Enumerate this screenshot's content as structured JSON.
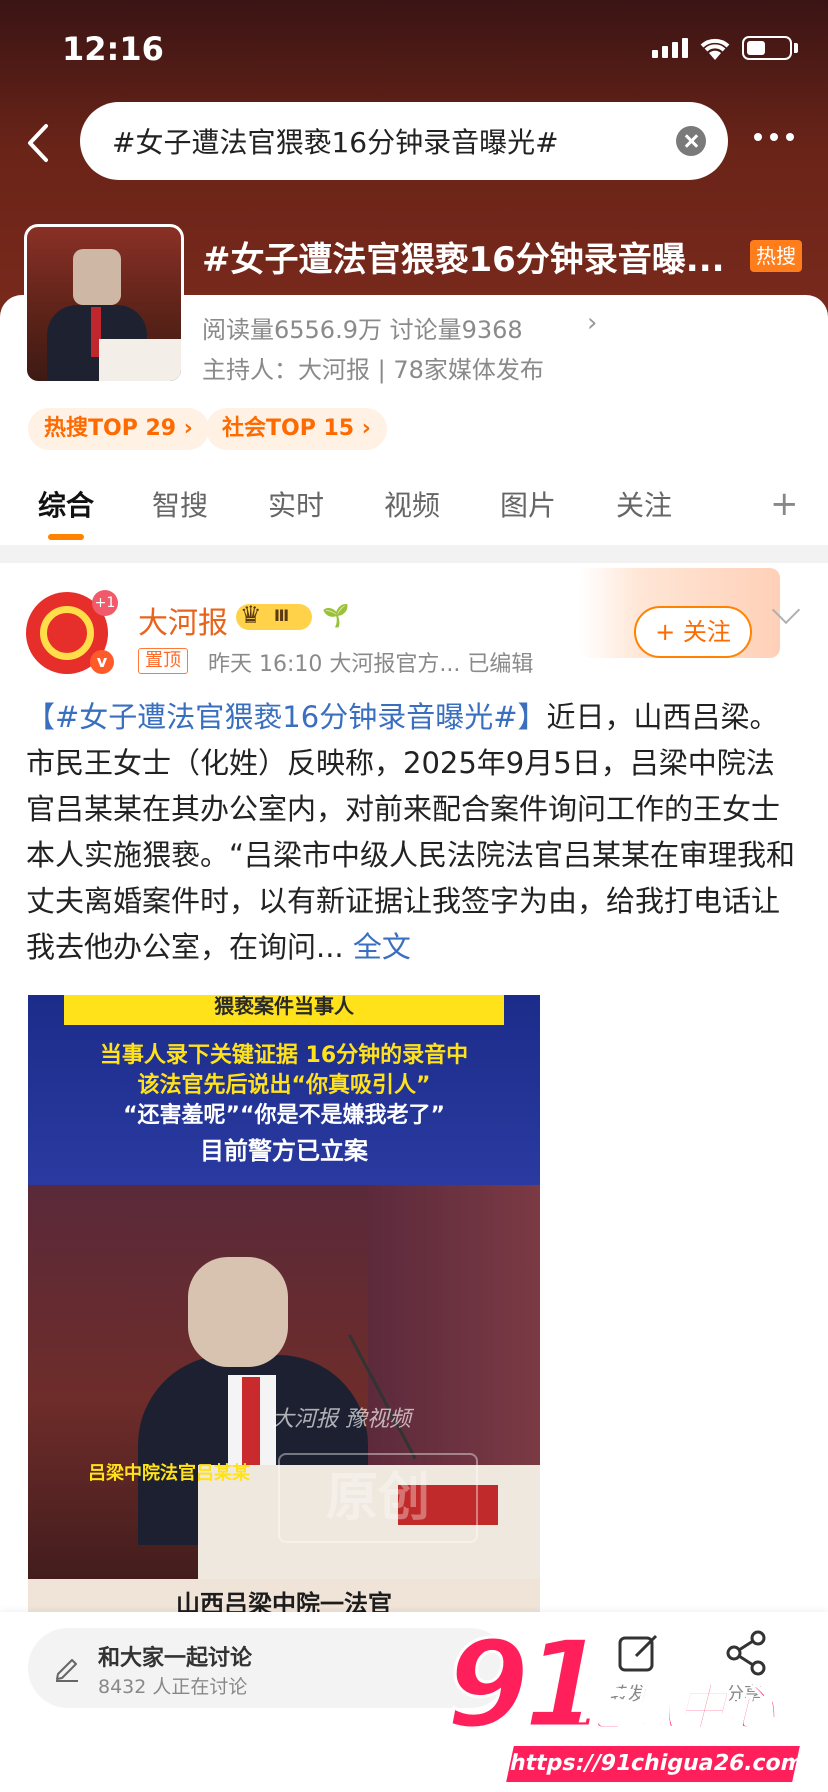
{
  "status_bar": {
    "time": "12:16"
  },
  "search": {
    "query": "#女子遭法官猥亵16分钟录音曝光#"
  },
  "topic": {
    "title": "#女子遭法官猥亵16分钟录音曝...",
    "hot_badge": "热搜",
    "stats": "阅读量6556.9万  讨论量9368",
    "host": "主持人：大河报 | 78家媒体发布",
    "rank_tags": [
      "热搜TOP 29 ›",
      "社会TOP 15 ›"
    ]
  },
  "tabs": [
    "综合",
    "智搜",
    "实时",
    "视频",
    "图片",
    "关注"
  ],
  "post": {
    "author": "大河报",
    "avatar_plus": "+1",
    "avatar_v": "v",
    "pin_label": "置顶",
    "meta": "昨天 16:10  大河报官方...  已编辑",
    "follow_label": "+ 关注",
    "body_hashtag": "【#女子遭法官猥亵16分钟录音曝光#】",
    "body_text": "近日，山西吕梁。市民王女士（化姓）反映称，2025年9月5日，吕梁中院法官吕某某在其办公室内，对前来配合案件询问工作的王女士本人实施猥亵。“吕梁市中级人民法院法官吕某某在审理我和丈夫离婚案件时，以有新证据让我签字为由，给我打电话让我去他办公室，在询问...",
    "body_more": "全文"
  },
  "video": {
    "top_bar": "猥亵案件当事人",
    "cap1": "当事人录下关键证据 16分钟的录音中",
    "cap2": "该法官先后说出“你真吸引人”",
    "cap3": "“还害羞呢”“你是不是嫌我老了”",
    "cap4": "目前警方已立案",
    "watermark": "大河报  豫视频",
    "stamp": "原创",
    "name_caption": "吕梁中院法官吕某某",
    "bottom_caption": "山西吕梁中院一法官"
  },
  "bottom": {
    "discuss_title": "和大家一起讨论",
    "discuss_sub": "8432 人正在讨论",
    "label_left": "转发",
    "label_right": "分享"
  },
  "watermark91": {
    "number": "91",
    "text": "吃瓜中心",
    "url": "https://91chigua26.com"
  },
  "colors": {
    "accent": "#ff8200",
    "link": "#3a6fc0",
    "author": "#e8641b"
  }
}
